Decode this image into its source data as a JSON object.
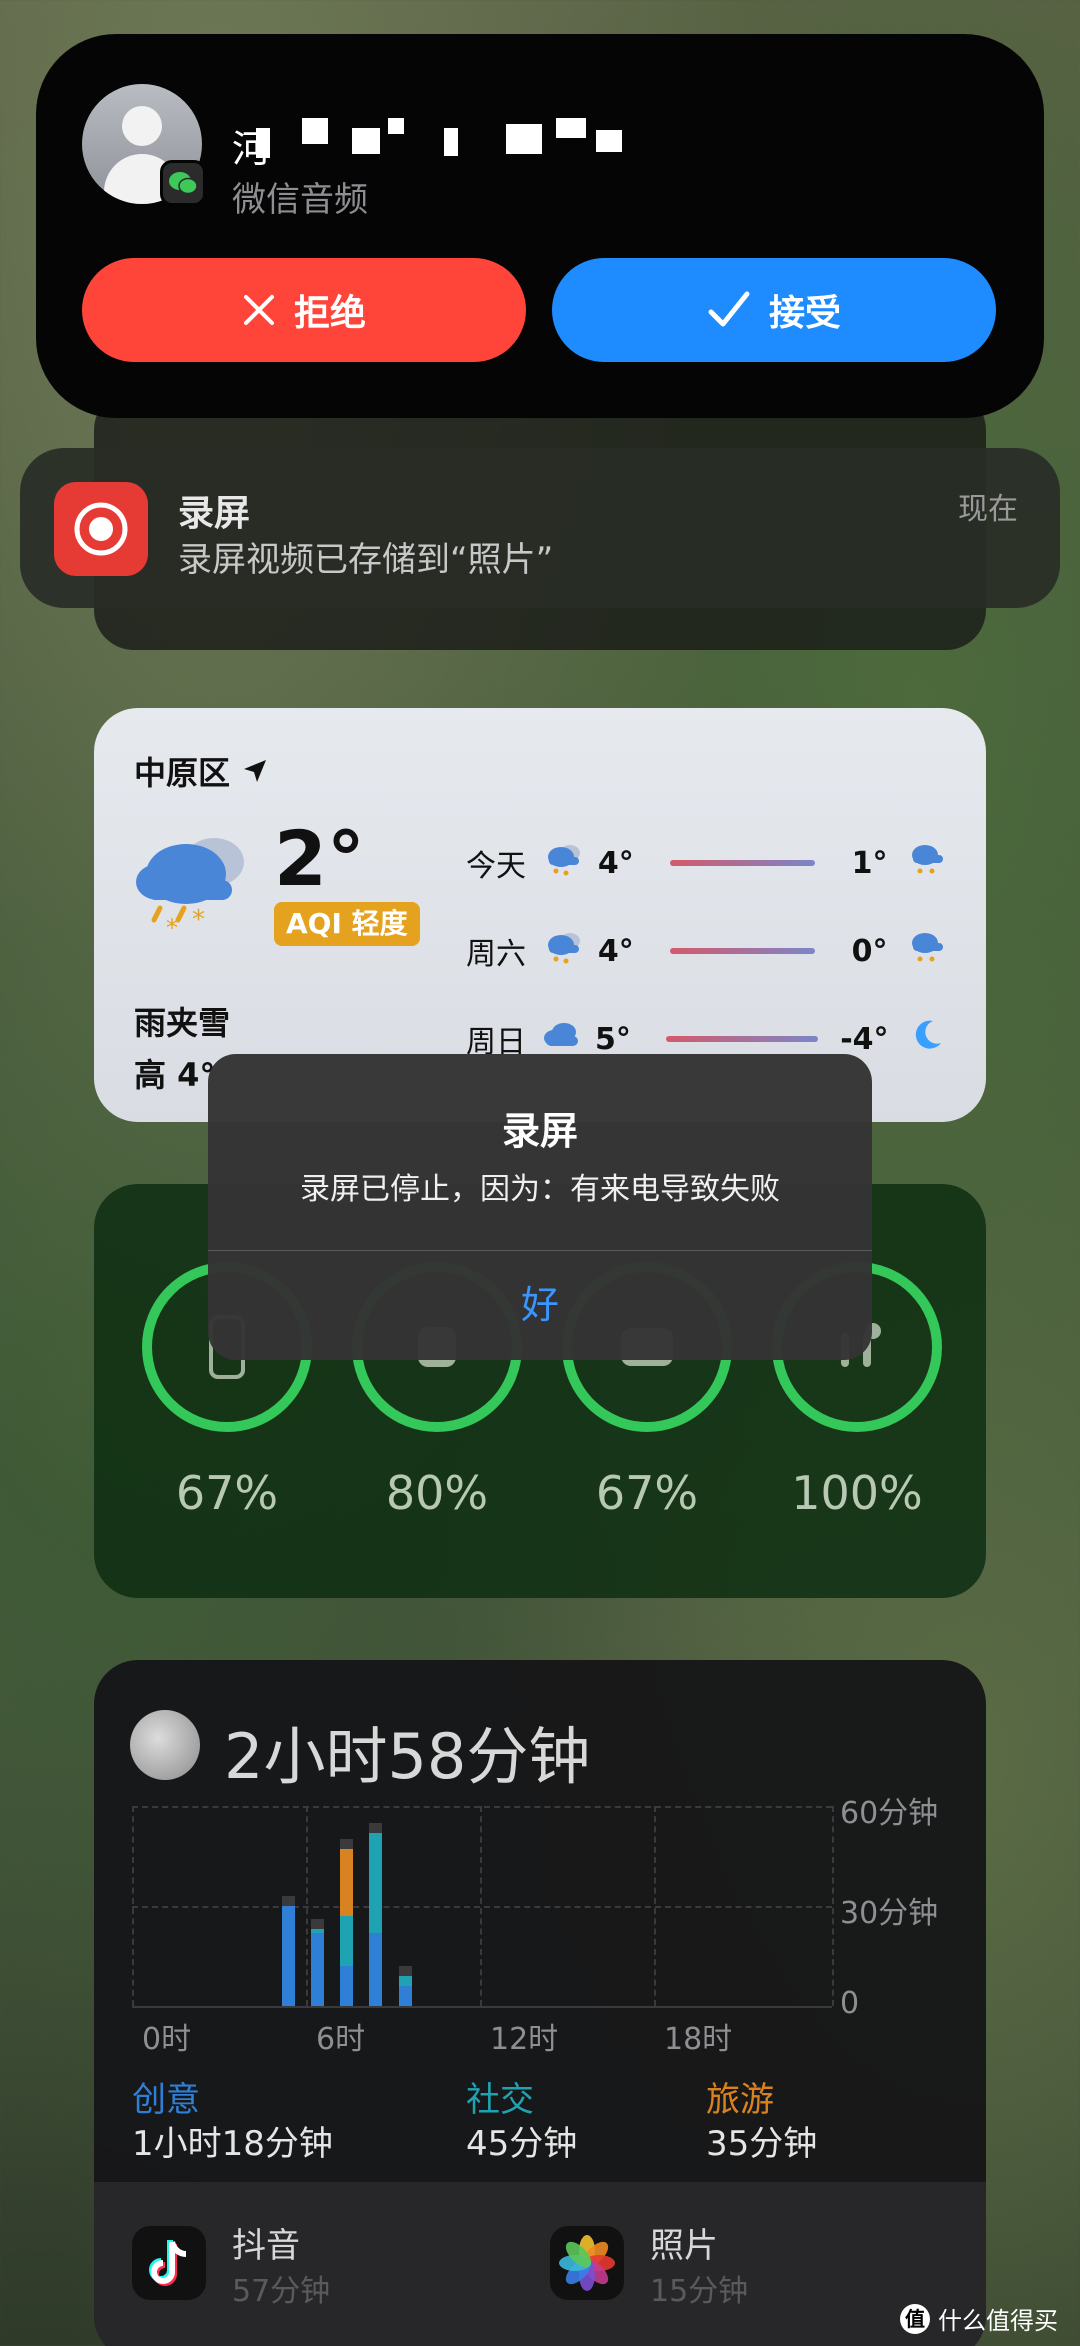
{
  "call": {
    "caller_name": "河",
    "subtitle": "微信音频",
    "decline_label": "拒绝",
    "accept_label": "接受"
  },
  "notification": {
    "app": "录屏",
    "message": "录屏视频已存储到“照片”",
    "time": "现在"
  },
  "weather": {
    "city": "中原区",
    "temperature": "2°",
    "aqi": "AQI 轻度",
    "condition": "雨夹雪",
    "high_low": "高 4°",
    "forecast": [
      {
        "day": "今天",
        "low": "4°",
        "high": "1°",
        "icon": "sleet-icon"
      },
      {
        "day": "周六",
        "low": "4°",
        "high": "0°",
        "icon": "sleet-icon"
      },
      {
        "day": "周日",
        "low": "5°",
        "high": "-4°",
        "icon": "cloud-icon"
      }
    ]
  },
  "alert": {
    "title": "录屏",
    "message": "录屏已停止，因为：有来电导致失败",
    "ok": "好"
  },
  "battery": {
    "items": [
      {
        "name": "phone",
        "percent": "67%",
        "level": 0.67
      },
      {
        "name": "watch",
        "percent": "80%",
        "level": 0.8
      },
      {
        "name": "case",
        "percent": "67%",
        "level": 0.67
      },
      {
        "name": "airpods",
        "percent": "100%",
        "level": 1.0
      }
    ],
    "ring_color": "#34c759"
  },
  "screen_time": {
    "total": "2小时58分钟",
    "y_labels": [
      "60分钟",
      "30分钟",
      "0"
    ],
    "x_labels": [
      "0时",
      "6时",
      "12时",
      "18时"
    ],
    "categories": [
      {
        "name": "创意",
        "value": "1小时18分钟",
        "color": "#2f7fd6"
      },
      {
        "name": "社交",
        "value": "45分钟",
        "color": "#1fa3b3"
      },
      {
        "name": "旅游",
        "value": "35分钟",
        "color": "#d98221"
      }
    ],
    "apps": [
      {
        "name": "抖音",
        "time": "57分钟"
      },
      {
        "name": "照片",
        "time": "15分钟"
      }
    ]
  },
  "watermark": "什么值得买",
  "chart_data": {
    "type": "bar",
    "x_hours": [
      5,
      6,
      7,
      8,
      9
    ],
    "series": [
      {
        "name": "创意",
        "values": [
          30,
          22,
          12,
          22,
          6
        ]
      },
      {
        "name": "社交",
        "values": [
          0,
          1,
          15,
          30,
          3
        ]
      },
      {
        "name": "旅游",
        "values": [
          0,
          0,
          20,
          0,
          0
        ]
      }
    ],
    "ylim": [
      0,
      60
    ],
    "ylabels": [
      "60分钟",
      "30分钟",
      "0"
    ],
    "xlabels": [
      "0时",
      "6时",
      "12时",
      "18时"
    ]
  }
}
